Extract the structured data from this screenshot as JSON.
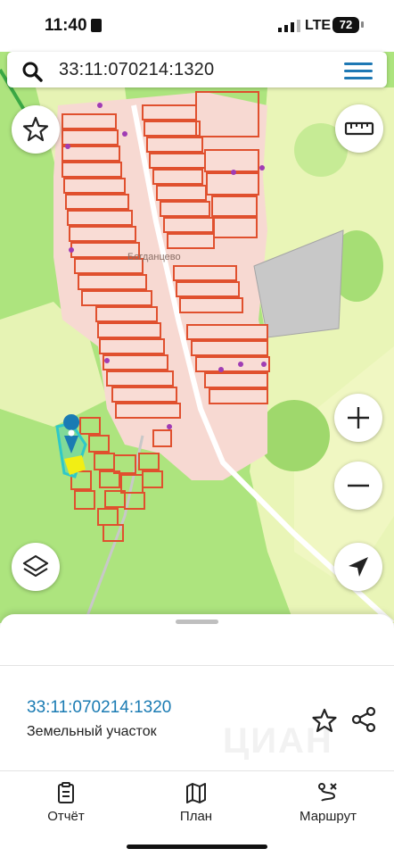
{
  "status_bar": {
    "time": "11:40",
    "network": "LTE",
    "battery": "72"
  },
  "search": {
    "query": "33:11:070214:1320",
    "search_icon": "search-icon",
    "menu_icon": "hamburger-menu-icon"
  },
  "map": {
    "village_label": "Богданцево",
    "colors": {
      "forest": "#ade47e",
      "meadow": "#e9f5b7",
      "parcel_stroke": "#e0502e",
      "parcel_fill": "#f7d9d2",
      "selected": "#2fc8c8",
      "highlight": "#f2ee14"
    },
    "controls": [
      "favorite-star-icon",
      "ruler-icon",
      "zoom-in-icon",
      "zoom-out-icon",
      "layers-icon",
      "locate-arrow-icon"
    ]
  },
  "sheet": {
    "parcel_id": "33:11:070214:1320",
    "parcel_type": "Земельный участок",
    "watermark": "ЦИАН"
  },
  "tabs": [
    {
      "label": "Отчёт",
      "icon": "report-icon"
    },
    {
      "label": "План",
      "icon": "map-plan-icon"
    },
    {
      "label": "Маршрут",
      "icon": "route-icon"
    }
  ],
  "colors": {
    "accent": "#1a7bb3"
  }
}
